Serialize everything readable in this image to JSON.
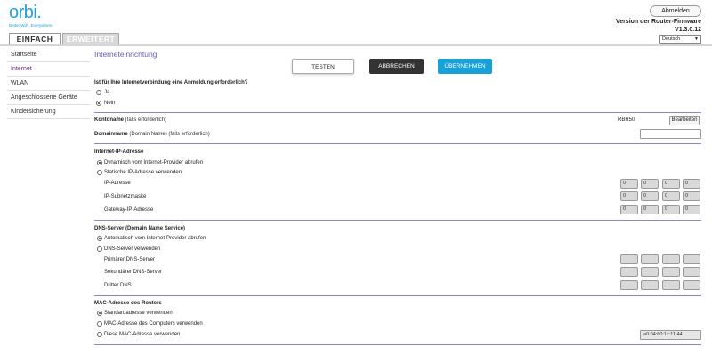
{
  "header": {
    "logo_text": "orbi.",
    "logo_tagline": "Better WiFi. Everywhere.",
    "logout_label": "Abmelden",
    "firmware_label": "Version der Router-Firmware",
    "firmware_version": "V1.3.0.12",
    "language_selected": "Deutsch",
    "tabs": [
      {
        "label": "EINFACH",
        "active": true
      },
      {
        "label": "ERWEITERT",
        "active": false
      }
    ]
  },
  "sidebar": {
    "items": [
      {
        "label": "Startseite",
        "active": false
      },
      {
        "label": "Internet",
        "active": true
      },
      {
        "label": "WLAN",
        "active": false
      },
      {
        "label": "Angeschlossene Geräte",
        "active": false
      },
      {
        "label": "Kindersicherung",
        "active": false
      }
    ]
  },
  "main": {
    "title": "Interneteinrichtung",
    "buttons": {
      "test": "TESTEN",
      "cancel": "ABBRECHEN",
      "apply": "ÜBERNEHMEN"
    },
    "login_question": "Ist für Ihre Internetverbindung eine Anmeldung erforderlich?",
    "login_options": [
      "Ja",
      "Nein"
    ],
    "login_selected": "Nein",
    "account": {
      "label": "Kontoname",
      "hint": "(falls erforderlich)",
      "value": "RBR50",
      "edit_label": "Bearbeiten"
    },
    "domain": {
      "label": "Domainname",
      "hint": "(Domain Name) (falls erforderlich)",
      "value": ""
    },
    "internet_ip": {
      "heading": "Internet-IP-Adresse",
      "options": [
        "Dynamisch vom Internet-Provider abrufen",
        "Statische IP-Adresse verwenden"
      ],
      "selected": "Dynamisch vom Internet-Provider abrufen",
      "fields": [
        {
          "label": "IP-Adresse",
          "octets": [
            "0",
            "0",
            "0",
            "0"
          ]
        },
        {
          "label": "IP-Subnetzmaske",
          "octets": [
            "0",
            "0",
            "0",
            "0"
          ]
        },
        {
          "label": "Gateway-IP-Adresse",
          "octets": [
            "0",
            "0",
            "0",
            "0"
          ]
        }
      ]
    },
    "dns": {
      "heading": "DNS-Server (Domain Name Service)",
      "options": [
        "Automatisch vom Internet-Provider abrufen",
        "DNS-Server verwenden"
      ],
      "selected": "Automatisch vom Internet-Provider abrufen",
      "fields": [
        {
          "label": "Primärer DNS-Server",
          "octets": [
            "",
            "",
            "",
            ""
          ]
        },
        {
          "label": "Sekundärer DNS-Server",
          "octets": [
            "",
            "",
            "",
            ""
          ]
        },
        {
          "label": "Dritter DNS",
          "octets": [
            "",
            "",
            "",
            ""
          ]
        }
      ]
    },
    "mac": {
      "heading": "MAC-Adresse des Routers",
      "options": [
        "Standardadresse verwenden",
        "MAC-Adresse des Computers verwenden",
        "Diese MAC-Adresse verwenden"
      ],
      "selected": "Standardadresse verwenden",
      "custom_value": "a0:04:60:1c:11:44"
    }
  },
  "colors": {
    "brand": "#21a0d8",
    "active_nav": "#6b2a8c",
    "title": "#6b5ab4",
    "divider": "#8b88cc",
    "apply_button": "#18a1d9",
    "cancel_button": "#333333"
  }
}
